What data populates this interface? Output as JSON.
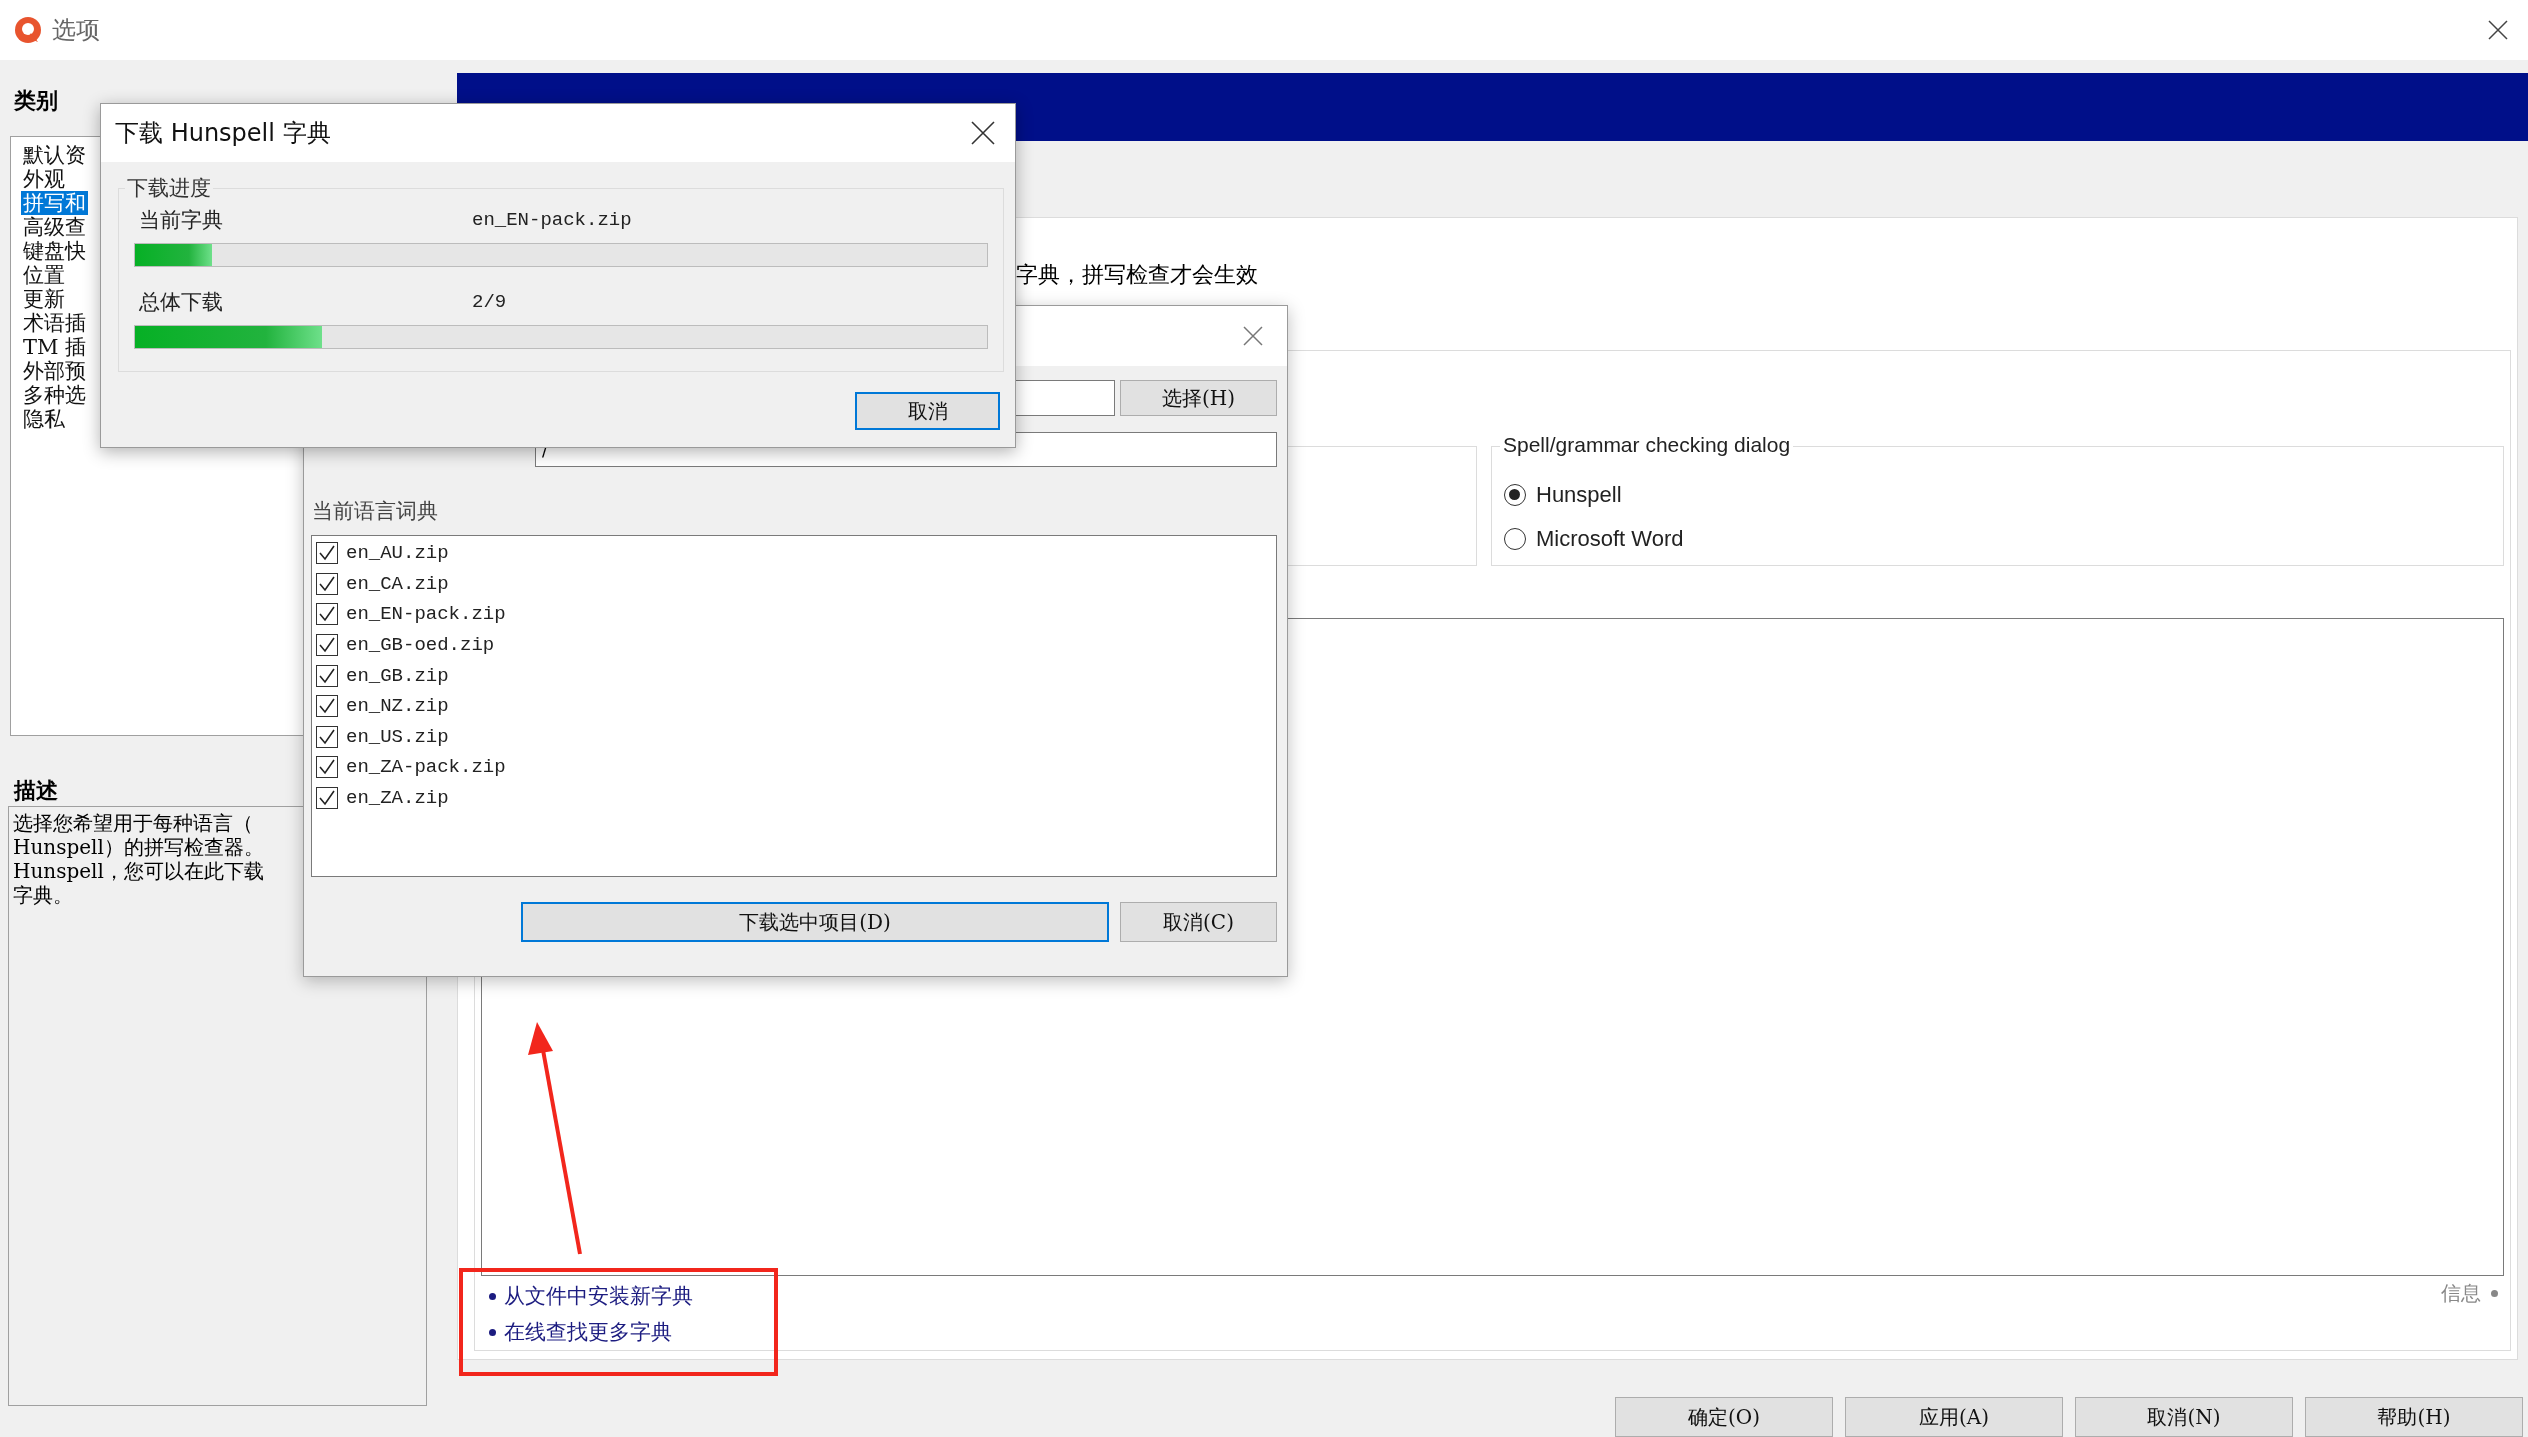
{
  "window": {
    "title": "选项"
  },
  "categories": {
    "label": "类别",
    "items": [
      {
        "label": "默认资",
        "selected": false
      },
      {
        "label": "外观",
        "selected": false
      },
      {
        "label": "拼写和",
        "selected": true
      },
      {
        "label": "高级查",
        "selected": false
      },
      {
        "label": "键盘快",
        "selected": false
      },
      {
        "label": "位置",
        "selected": false
      },
      {
        "label": "更新",
        "selected": false
      },
      {
        "label": "术语插",
        "selected": false
      },
      {
        "label": "TM 插",
        "selected": false
      },
      {
        "label": "外部预",
        "selected": false
      },
      {
        "label": "多种选",
        "selected": false
      },
      {
        "label": "隐私",
        "selected": false
      }
    ]
  },
  "description": {
    "label": "描述",
    "lines": [
      "选择您希望用于每种语言（",
      "Hunspell）的拼写检查器。",
      "Hunspell，您可以在此下载",
      "字典。"
    ]
  },
  "page": {
    "notice": "字典，拼写检查才会生效",
    "checking_dialog": {
      "legend": "Spell/grammar checking dialog",
      "options": [
        {
          "label": "Hunspell",
          "selected": true
        },
        {
          "label": "Microsoft Word",
          "selected": false
        }
      ]
    },
    "links": [
      "从文件中安装新字典",
      "在线查找更多字典"
    ],
    "info": "信息"
  },
  "buttons": [
    "确定(O)",
    "应用(A)",
    "取消(N)",
    "帮助(H)"
  ],
  "dictionary_dialog": {
    "select_button": "选择(H)",
    "remote_dir_value": "/",
    "list_label": "当前语言词典",
    "items": [
      {
        "label": "en_AU.zip",
        "checked": true
      },
      {
        "label": "en_CA.zip",
        "checked": true
      },
      {
        "label": "en_EN-pack.zip",
        "checked": true
      },
      {
        "label": "en_GB-oed.zip",
        "checked": true
      },
      {
        "label": "en_GB.zip",
        "checked": true
      },
      {
        "label": "en_NZ.zip",
        "checked": true
      },
      {
        "label": "en_US.zip",
        "checked": true
      },
      {
        "label": "en_ZA-pack.zip",
        "checked": true
      },
      {
        "label": "en_ZA.zip",
        "checked": true
      }
    ],
    "buttons": [
      {
        "label": "下载选中项目(D)",
        "focused": true
      },
      {
        "label": "取消(C)",
        "focused": false
      }
    ]
  },
  "progress_dialog": {
    "title": "下载 Hunspell 字典",
    "group": "下载进度",
    "rows": [
      {
        "label": "当前字典",
        "value": "en_EN-pack.zip",
        "level": 0.09
      },
      {
        "label": "总体下载",
        "value": "2/9",
        "level": 0.22
      }
    ],
    "buttons": [
      {
        "label": "取消",
        "focused": true
      }
    ]
  }
}
